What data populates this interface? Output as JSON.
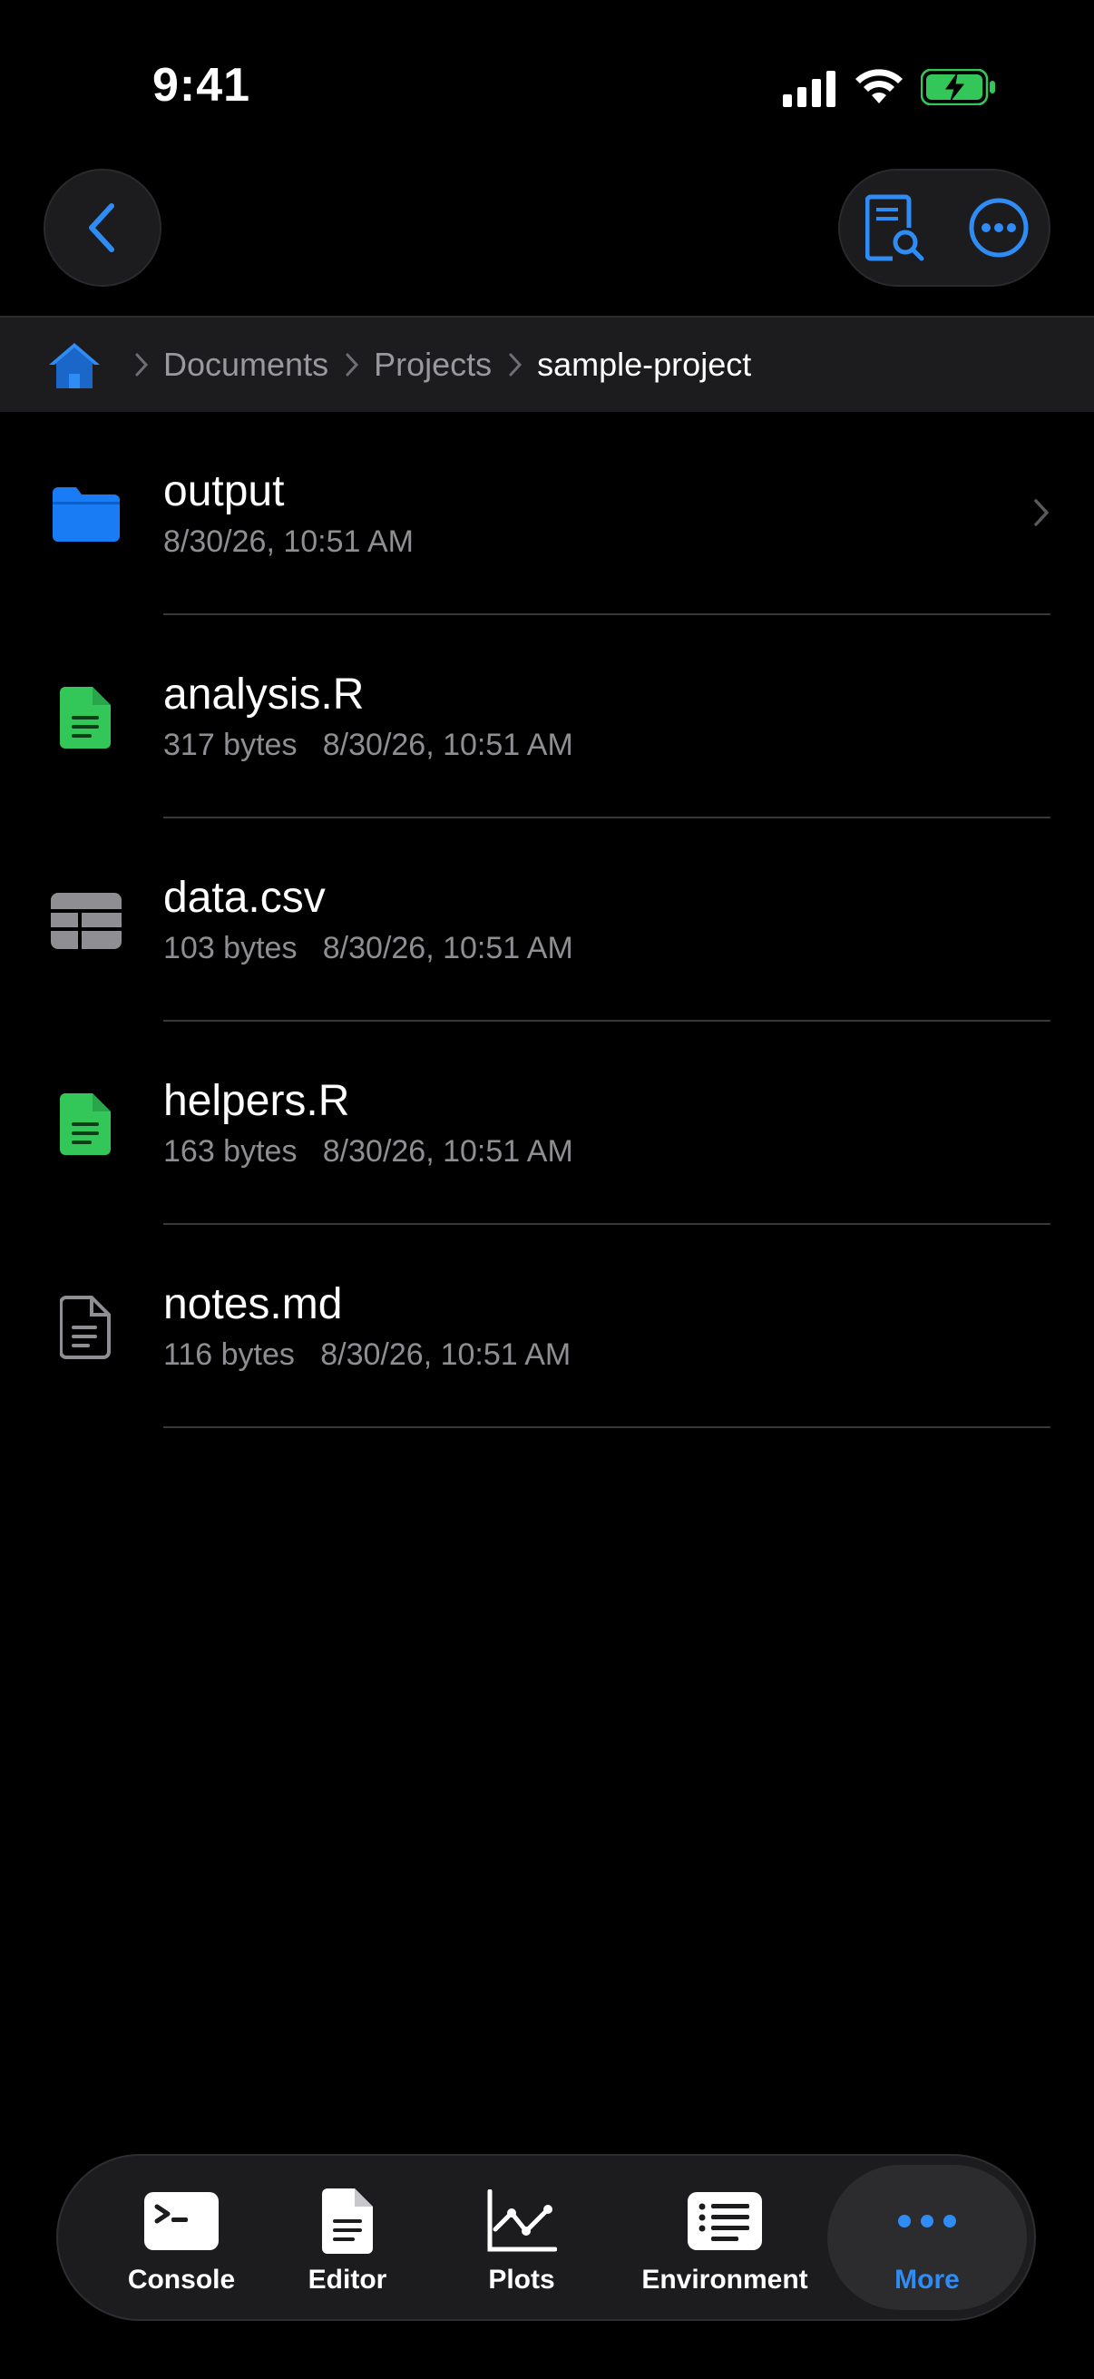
{
  "status_bar": {
    "time": "9:41"
  },
  "breadcrumb": {
    "items": [
      "Documents",
      "Projects",
      "sample-project"
    ]
  },
  "files": [
    {
      "name": "output",
      "meta": "8/30/26, 10:51 AM",
      "icon": "folder-icon"
    },
    {
      "name": "analysis.R",
      "meta": "317 bytes   8/30/26, 10:51 AM",
      "icon": "r-file-icon"
    },
    {
      "name": "data.csv",
      "meta": "103 bytes   8/30/26, 10:51 AM",
      "icon": "table-icon"
    },
    {
      "name": "helpers.R",
      "meta": "163 bytes   8/30/26, 10:51 AM",
      "icon": "r-file-icon"
    },
    {
      "name": "notes.md",
      "meta": "116 bytes   8/30/26, 10:51 AM",
      "icon": "document-icon"
    }
  ],
  "tabbar": {
    "tabs": [
      "Console",
      "Editor",
      "Plots",
      "Environment",
      "More"
    ],
    "active": "More"
  },
  "colors": {
    "accent": "#2f8cf5",
    "folder": "#1a7cf5",
    "r_file": "#33c759",
    "background": "#000000",
    "surface": "#1c1c1e"
  }
}
